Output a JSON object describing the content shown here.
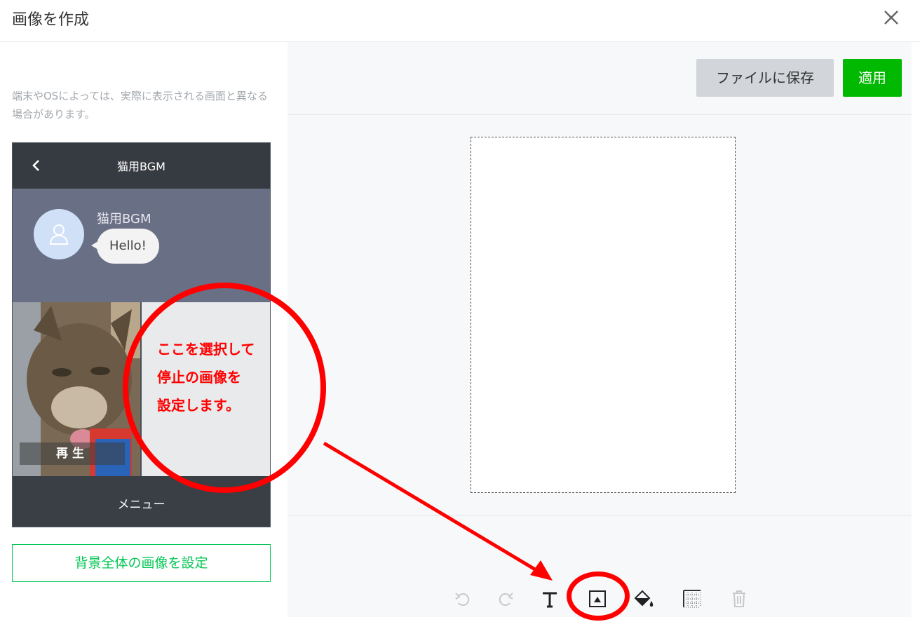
{
  "dialog": {
    "title": "画像を作成",
    "close_icon": "close-icon"
  },
  "left": {
    "note": "端末やOSによっては、実際に表示される画面と異なる場合があります。",
    "phone": {
      "header_title": "猫用BGM",
      "bot_name": "猫用BGM",
      "message": "Hello!",
      "play_label": "再生",
      "menu_label": "メニュー"
    },
    "background_button": "背景全体の画像を設定"
  },
  "right": {
    "save_button": "ファイルに保存",
    "apply_button": "適用",
    "tools": [
      "undo-icon",
      "redo-icon",
      "text-icon",
      "image-icon",
      "fill-icon",
      "grid-icon",
      "trash-icon"
    ]
  },
  "annotation": {
    "line1": "ここを選択して",
    "line2": "停止の画像を",
    "line3": "設定します。"
  },
  "colors": {
    "accent": "#00b900",
    "annotation": "#ff0000"
  }
}
